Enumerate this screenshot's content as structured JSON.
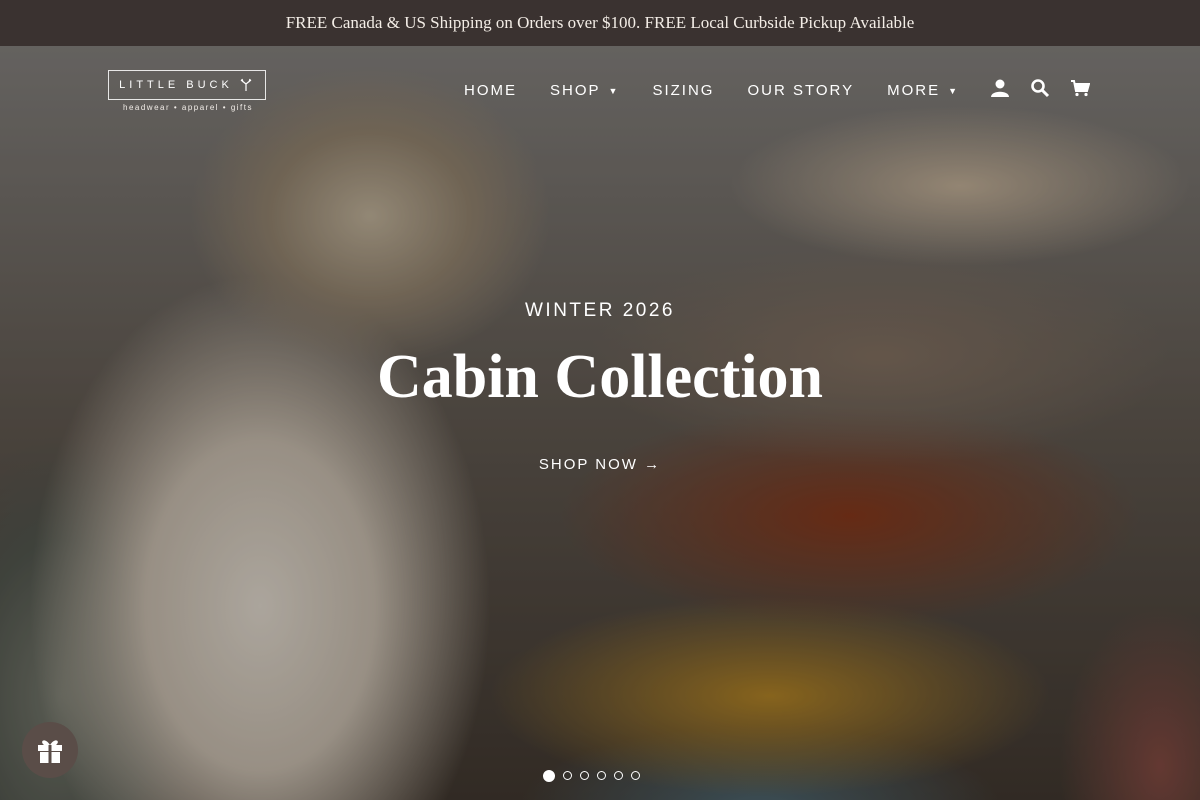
{
  "announcement": "FREE Canada & US Shipping on Orders over $100. FREE Local Curbside Pickup Available",
  "logo": {
    "name": "LITTLE BUCK",
    "tagline": "headwear • apparel • gifts"
  },
  "nav": {
    "items": [
      {
        "label": "HOME",
        "has_dropdown": false
      },
      {
        "label": "SHOP",
        "has_dropdown": true
      },
      {
        "label": "SIZING",
        "has_dropdown": false
      },
      {
        "label": "OUR STORY",
        "has_dropdown": false
      },
      {
        "label": "MORE",
        "has_dropdown": true
      }
    ],
    "icons": [
      "account-icon",
      "search-icon",
      "cart-icon"
    ]
  },
  "hero": {
    "eyebrow": "WINTER 2026",
    "headline": "Cabin Collection",
    "cta": "SHOP NOW →"
  },
  "slider": {
    "total": 6,
    "active": 1
  },
  "colors": {
    "announcement_bg": "#3a3230",
    "text": "#ffffff"
  }
}
